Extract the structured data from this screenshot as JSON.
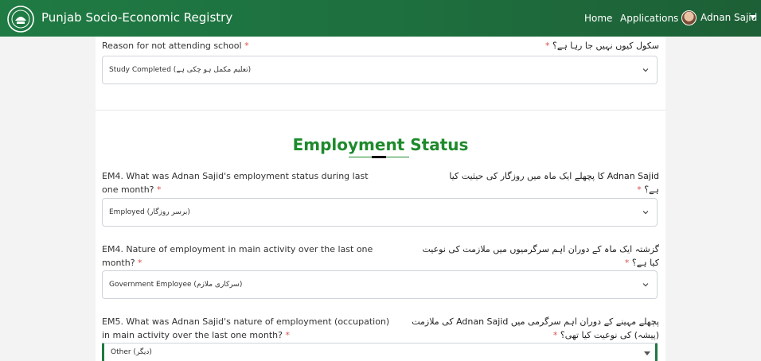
{
  "header": {
    "brand": "Punjab Socio-Economic Registry",
    "nav_home": "Home",
    "nav_applications": "Applications",
    "user_name": "Adnan Sajid"
  },
  "q_school": {
    "label": "Reason for not attending school",
    "required": "*",
    "urdu": "سکول کیوں نہیں جا رہا ہے؟",
    "value": "Study Completed (تعلیم مکمل ہو چکی ہے)"
  },
  "section": {
    "title": "Employment Status"
  },
  "q_em4_status": {
    "label": "EM4. What was Adnan Sajid's employment status during last one month?",
    "required": "*",
    "urdu": "Adnan Sajid کا پچھلے ایک ماہ میں روزگار کی حیثیت کیا ہے؟",
    "value": "Employed (برسر روزگار)"
  },
  "q_em4_nature": {
    "label": "EM4. Nature of employment in main activity over the last one month?",
    "required": "*",
    "urdu": "گزشتہ ایک ماہ کے دوران اہم سرگرمیوں میں ملازمت کی نوعیت کیا ہے؟",
    "value": "Government Employee (سرکاری ملازم)"
  },
  "q_em5": {
    "label": "EM5. What was Adnan Sajid's nature of employment (occupation) in main activity over the last one month?",
    "required": "*",
    "urdu": "پچھلے مہینے کے دوران اہم سرگرمی میں Adnan Sajid کی ملازمت (پیشہ) کی نوعیت کیا تھی؟",
    "value": "Other (دیگر)"
  },
  "colors": {
    "brand_green": "#1f7a43",
    "title_green": "#1e8a2c",
    "required_red": "#d9534f"
  },
  "icons": [
    "punjab-logo-icon",
    "avatar-icon",
    "caret-down-icon",
    "chevron-down-icon"
  ]
}
